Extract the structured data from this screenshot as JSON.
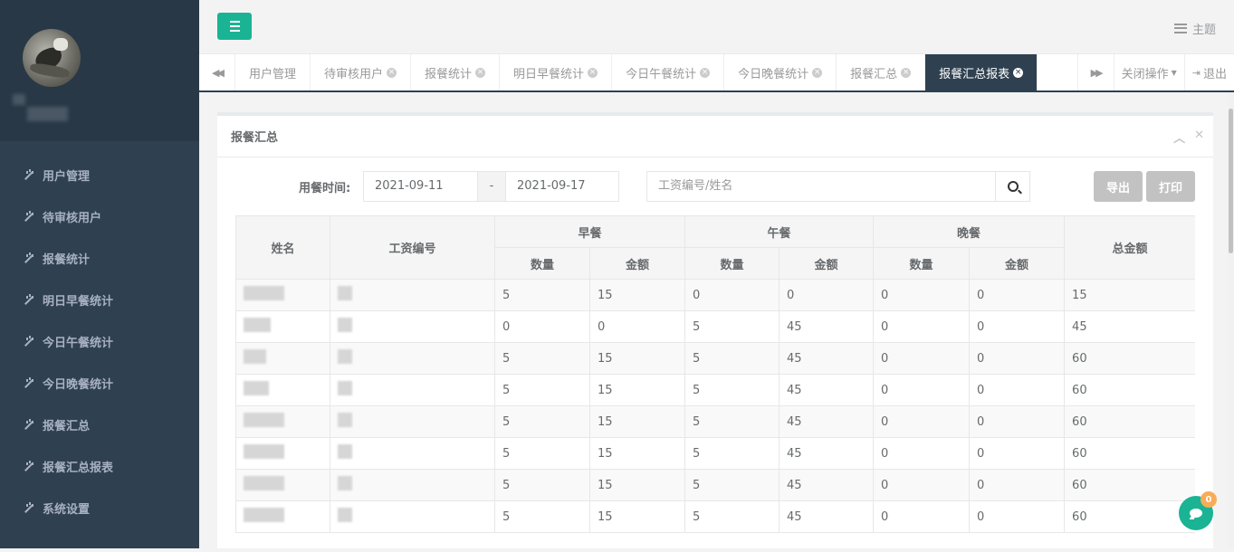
{
  "sidebar": {
    "items": [
      {
        "label": "用户管理"
      },
      {
        "label": "待审核用户"
      },
      {
        "label": "报餐统计"
      },
      {
        "label": "明日早餐统计"
      },
      {
        "label": "今日午餐统计"
      },
      {
        "label": "今日晚餐统计"
      },
      {
        "label": "报餐汇总"
      },
      {
        "label": "报餐汇总报表"
      },
      {
        "label": "系统设置"
      }
    ]
  },
  "header": {
    "theme_label": "主题"
  },
  "tabs": [
    {
      "label": "用户管理",
      "closable": false,
      "active": false
    },
    {
      "label": "待审核用户",
      "closable": true,
      "active": false
    },
    {
      "label": "报餐统计",
      "closable": true,
      "active": false
    },
    {
      "label": "明日早餐统计",
      "closable": true,
      "active": false
    },
    {
      "label": "今日午餐统计",
      "closable": true,
      "active": false
    },
    {
      "label": "今日晚餐统计",
      "closable": true,
      "active": false
    },
    {
      "label": "报餐汇总",
      "closable": true,
      "active": false
    },
    {
      "label": "报餐汇总报表",
      "closable": true,
      "active": true
    }
  ],
  "tab_actions": {
    "close_ops": "关闭操作",
    "logout": "退出"
  },
  "panel": {
    "title": "报餐汇总",
    "filter_label": "用餐时间:",
    "date_start": "2021-09-11",
    "date_sep": "-",
    "date_end": "2021-09-17",
    "search_placeholder": "工资编号/姓名",
    "export_label": "导出",
    "print_label": "打印"
  },
  "table": {
    "headers": {
      "name": "姓名",
      "emp_no": "工资编号",
      "breakfast": "早餐",
      "lunch": "午餐",
      "dinner": "晚餐",
      "total": "总金额",
      "qty": "数量",
      "amount": "金额"
    },
    "rows": [
      [
        "5",
        "15",
        "0",
        "0",
        "0",
        "0",
        "15"
      ],
      [
        "0",
        "0",
        "5",
        "45",
        "0",
        "0",
        "45"
      ],
      [
        "5",
        "15",
        "5",
        "45",
        "0",
        "0",
        "60"
      ],
      [
        "5",
        "15",
        "5",
        "45",
        "0",
        "0",
        "60"
      ],
      [
        "5",
        "15",
        "5",
        "45",
        "0",
        "0",
        "60"
      ],
      [
        "5",
        "15",
        "5",
        "45",
        "0",
        "0",
        "60"
      ],
      [
        "5",
        "15",
        "5",
        "45",
        "0",
        "0",
        "60"
      ],
      [
        "5",
        "15",
        "5",
        "45",
        "0",
        "0",
        "60"
      ]
    ]
  },
  "chat": {
    "badge": "0"
  },
  "colors": {
    "sidebar": "#2f4050",
    "accent": "#1ab394",
    "badge": "#f8ac59"
  }
}
